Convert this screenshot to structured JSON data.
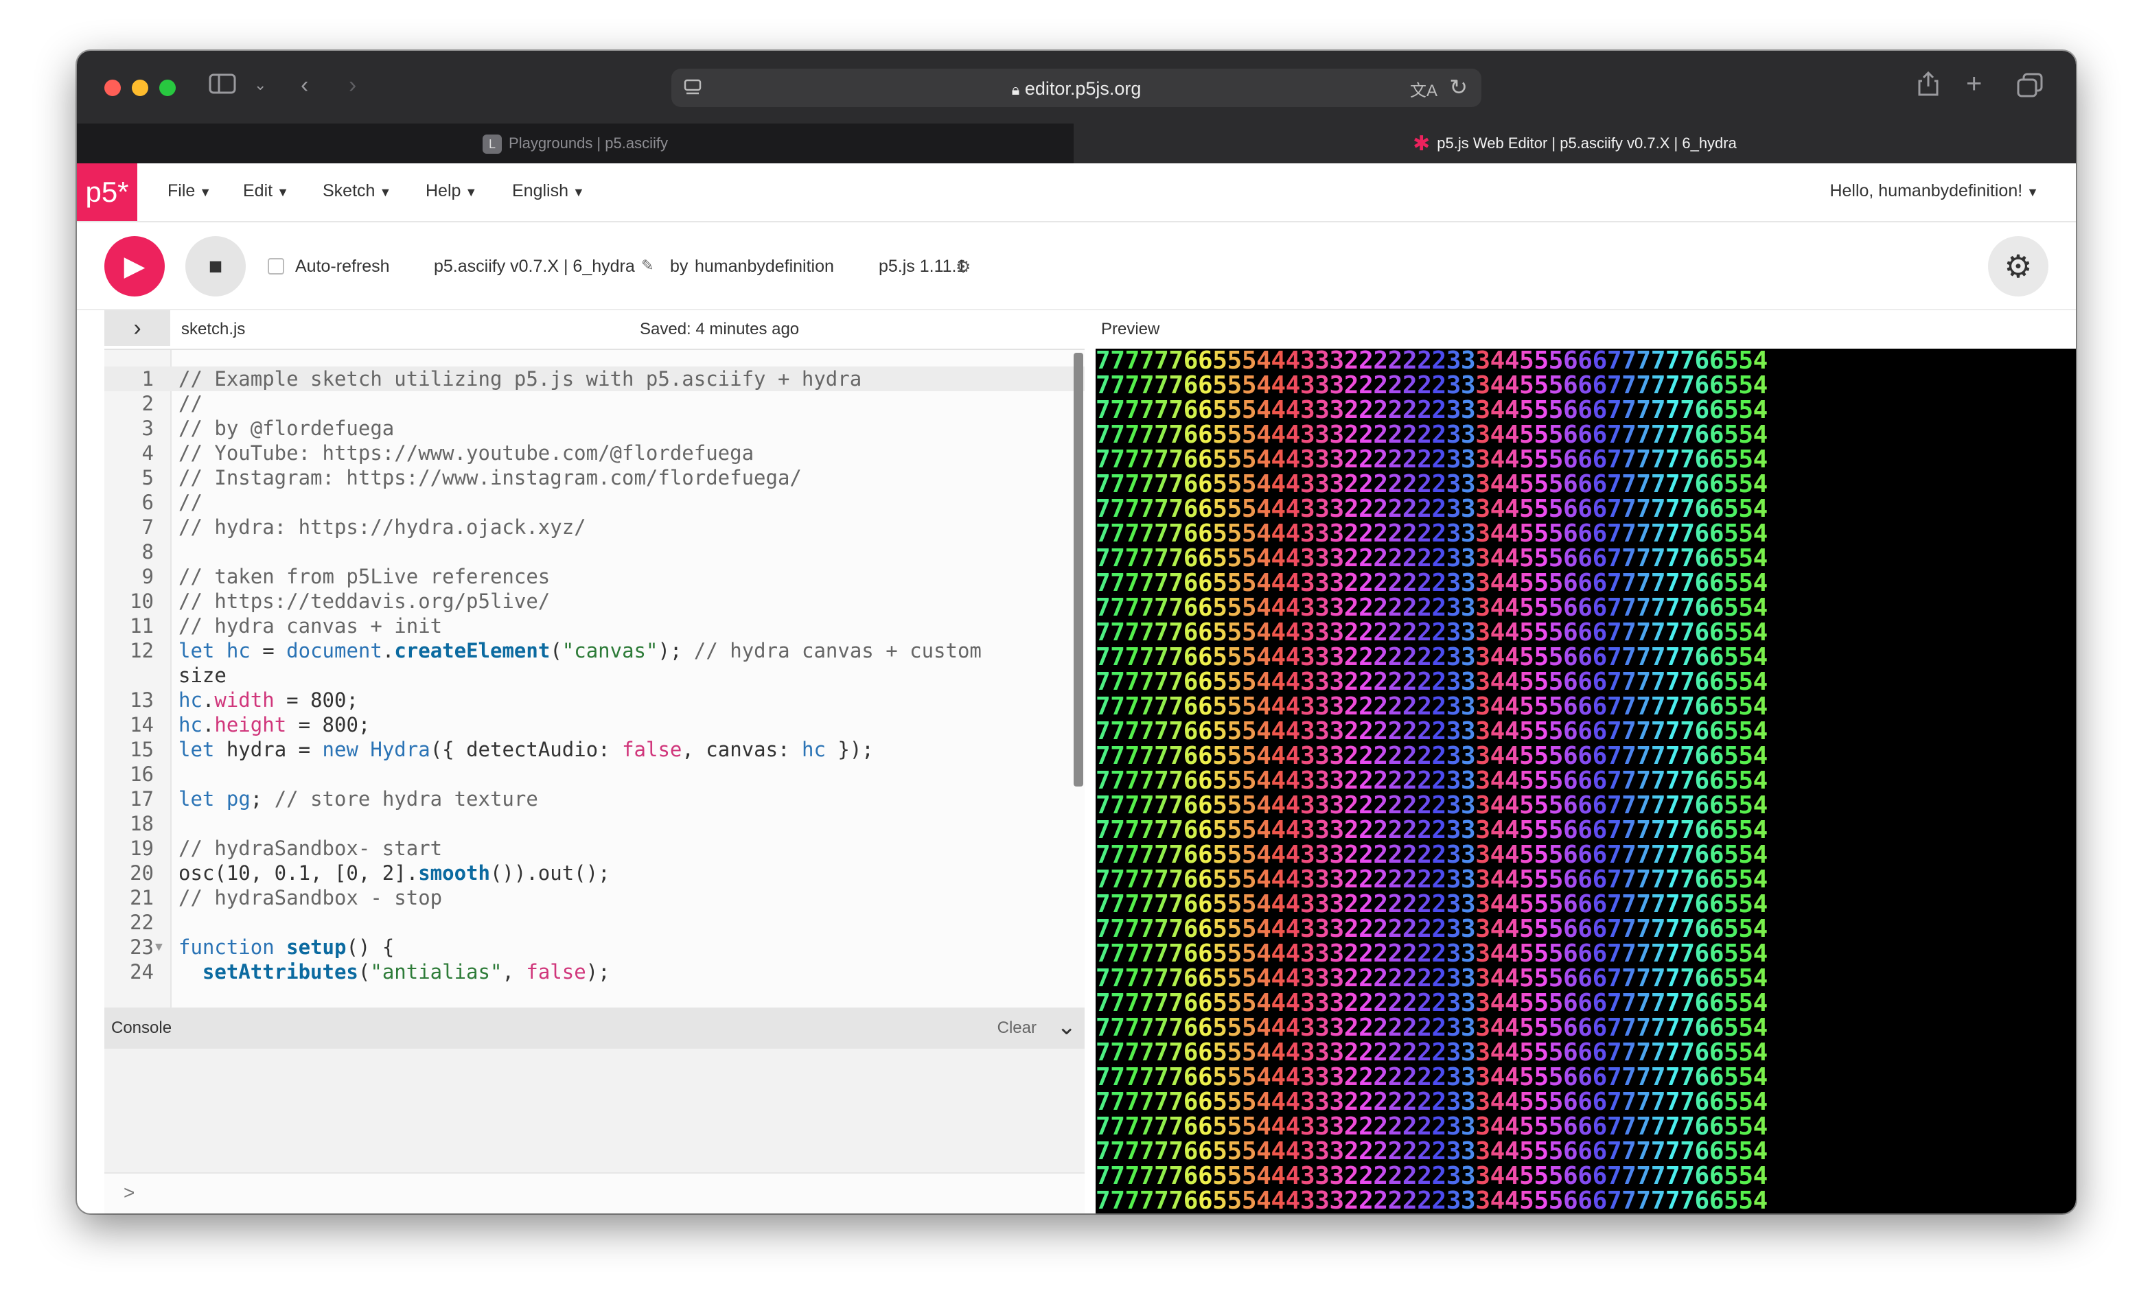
{
  "browser": {
    "url": "editor.p5js.org",
    "tabs": [
      {
        "label": "Playgrounds | p5.asciify",
        "favicon": "L",
        "active": false
      },
      {
        "label": "p5.js Web Editor | p5.asciify v0.7.X | 6_hydra",
        "active": true
      }
    ]
  },
  "nav": {
    "logo": "p5*",
    "menus": [
      "File",
      "Edit",
      "Sketch",
      "Help",
      "English"
    ],
    "user": "Hello, humanbydefinition!"
  },
  "toolbar": {
    "auto_refresh": "Auto-refresh",
    "project_name": "p5.asciify v0.7.X | 6_hydra",
    "by": "by",
    "author": "humanbydefinition",
    "version": "p5.js 1.11.1"
  },
  "filebar": {
    "filename": "sketch.js",
    "saved": "Saved: 4 minutes ago",
    "preview_label": "Preview"
  },
  "console": {
    "title": "Console",
    "clear": "Clear",
    "prompt": ">"
  },
  "colors": {
    "accent": "#ed225d",
    "digit_colors": {
      "7": "#7bf08a",
      "6": "#e8e06a",
      "5": "#f07a3a",
      "4": "#e8355a",
      "3": "#b02ad8",
      "2": "#4a2ee0",
      "3b": "#3d6ff0",
      "4b": "#3fa0e6",
      "5b": "#3ad0c8",
      "6b": "#8ae87a"
    }
  },
  "preview": {
    "ascii_row": "7777776655544433322222223334455566677777766554"
  },
  "code": [
    {
      "n": "1",
      "t": "// Example sketch utilizing p5.js with p5.asciify + hydra"
    },
    {
      "n": "2",
      "t": "//"
    },
    {
      "n": "3",
      "t": "// by @flordefuega"
    },
    {
      "n": "4",
      "t": "// YouTube: https://www.youtube.com/@flordefuega"
    },
    {
      "n": "5",
      "t": "// Instagram: https://www.instagram.com/flordefuega/"
    },
    {
      "n": "6",
      "t": "//"
    },
    {
      "n": "7",
      "t": "// hydra: https://hydra.ojack.xyz/"
    },
    {
      "n": "8",
      "t": ""
    },
    {
      "n": "9",
      "t": "// taken from p5Live references"
    },
    {
      "n": "10",
      "t": "// https://teddavis.org/p5live/"
    },
    {
      "n": "11",
      "t": "// hydra canvas + init"
    },
    {
      "n": "12",
      "t": "let hc = document.createElement(\"canvas\"); // hydra canvas + custom"
    },
    {
      "n": "",
      "t": "size"
    },
    {
      "n": "13",
      "t": "hc.width = 800;"
    },
    {
      "n": "14",
      "t": "hc.height = 800;"
    },
    {
      "n": "15",
      "t": "let hydra = new Hydra({ detectAudio: false, canvas: hc });"
    },
    {
      "n": "16",
      "t": ""
    },
    {
      "n": "17",
      "t": "let pg; // store hydra texture"
    },
    {
      "n": "18",
      "t": ""
    },
    {
      "n": "19",
      "t": "// hydraSandbox- start"
    },
    {
      "n": "20",
      "t": "osc(10, 0.1, [0, 2].smooth()).out();"
    },
    {
      "n": "21",
      "t": "// hydraSandbox - stop"
    },
    {
      "n": "22",
      "t": ""
    },
    {
      "n": "23",
      "t": "function setup() {"
    },
    {
      "n": "24",
      "t": "  setAttributes(\"antialias\", false);"
    }
  ]
}
